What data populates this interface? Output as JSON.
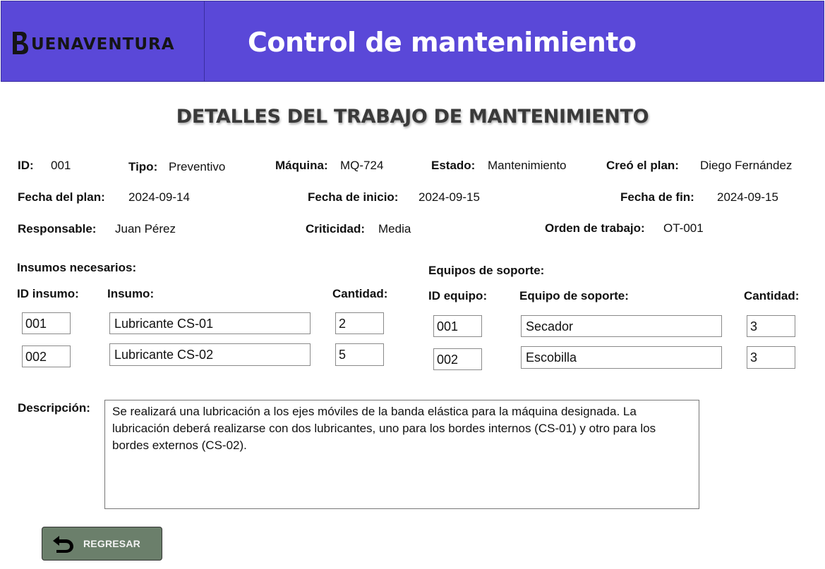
{
  "header": {
    "logo_text": "UENAVENTURA",
    "brand_name": "BUENAVENTURA",
    "title": "Control de mantenimiento"
  },
  "page": {
    "title": "DETALLES DEL TRABAJO DE MANTENIMIENTO"
  },
  "details": {
    "id": {
      "label": "ID:",
      "value": "001"
    },
    "tipo": {
      "label": "Tipo:",
      "value": "Preventivo"
    },
    "maquina": {
      "label": "Máquina:",
      "value": "MQ-724"
    },
    "estado": {
      "label": "Estado:",
      "value": "Mantenimiento"
    },
    "creo": {
      "label": "Creó el plan:",
      "value": "Diego Fernández"
    },
    "fecha_plan": {
      "label": "Fecha del plan:",
      "value": "2024-09-14"
    },
    "fecha_inicio": {
      "label": "Fecha de inicio:",
      "value": "2024-09-15"
    },
    "fecha_fin": {
      "label": "Fecha de fin:",
      "value": "2024-09-15"
    },
    "responsable": {
      "label": "Responsable:",
      "value": "Juan Pérez"
    },
    "criticidad": {
      "label": "Criticidad:",
      "value": "Media"
    },
    "orden": {
      "label": "Orden de trabajo:",
      "value": "OT-001"
    }
  },
  "insumos": {
    "section_label": "Insumos necesarios:",
    "headers": {
      "id": "ID insumo:",
      "name": "Insumo:",
      "qty": "Cantidad:"
    },
    "rows": [
      {
        "id": "001",
        "name": "Lubricante CS-01",
        "qty": "2"
      },
      {
        "id": "002",
        "name": "Lubricante CS-02",
        "qty": "5"
      }
    ]
  },
  "equipos": {
    "section_label": "Equipos de soporte:",
    "headers": {
      "id": "ID equipo:",
      "name": "Equipo de soporte:",
      "qty": "Cantidad:"
    },
    "rows": [
      {
        "id": "001",
        "name": "Secador",
        "qty": "3"
      },
      {
        "id": "002",
        "name": "Escobilla",
        "qty": "3"
      }
    ]
  },
  "descripcion": {
    "label": "Descripción:",
    "text": "Se realizará una lubricación a los ejes móviles de la banda elástica para la máquina designada. La lubricación deberá realizarse con dos lubricantes, uno para los bordes internos (CS-01) y otro para los bordes externos (CS-02)."
  },
  "actions": {
    "back_label": "REGRESAR"
  },
  "colors": {
    "header_bg": "#5a48d8",
    "button_bg": "#6b7f6b"
  },
  "icons": {
    "logo": "buenaventura-logo",
    "back": "back-arrow-icon"
  }
}
